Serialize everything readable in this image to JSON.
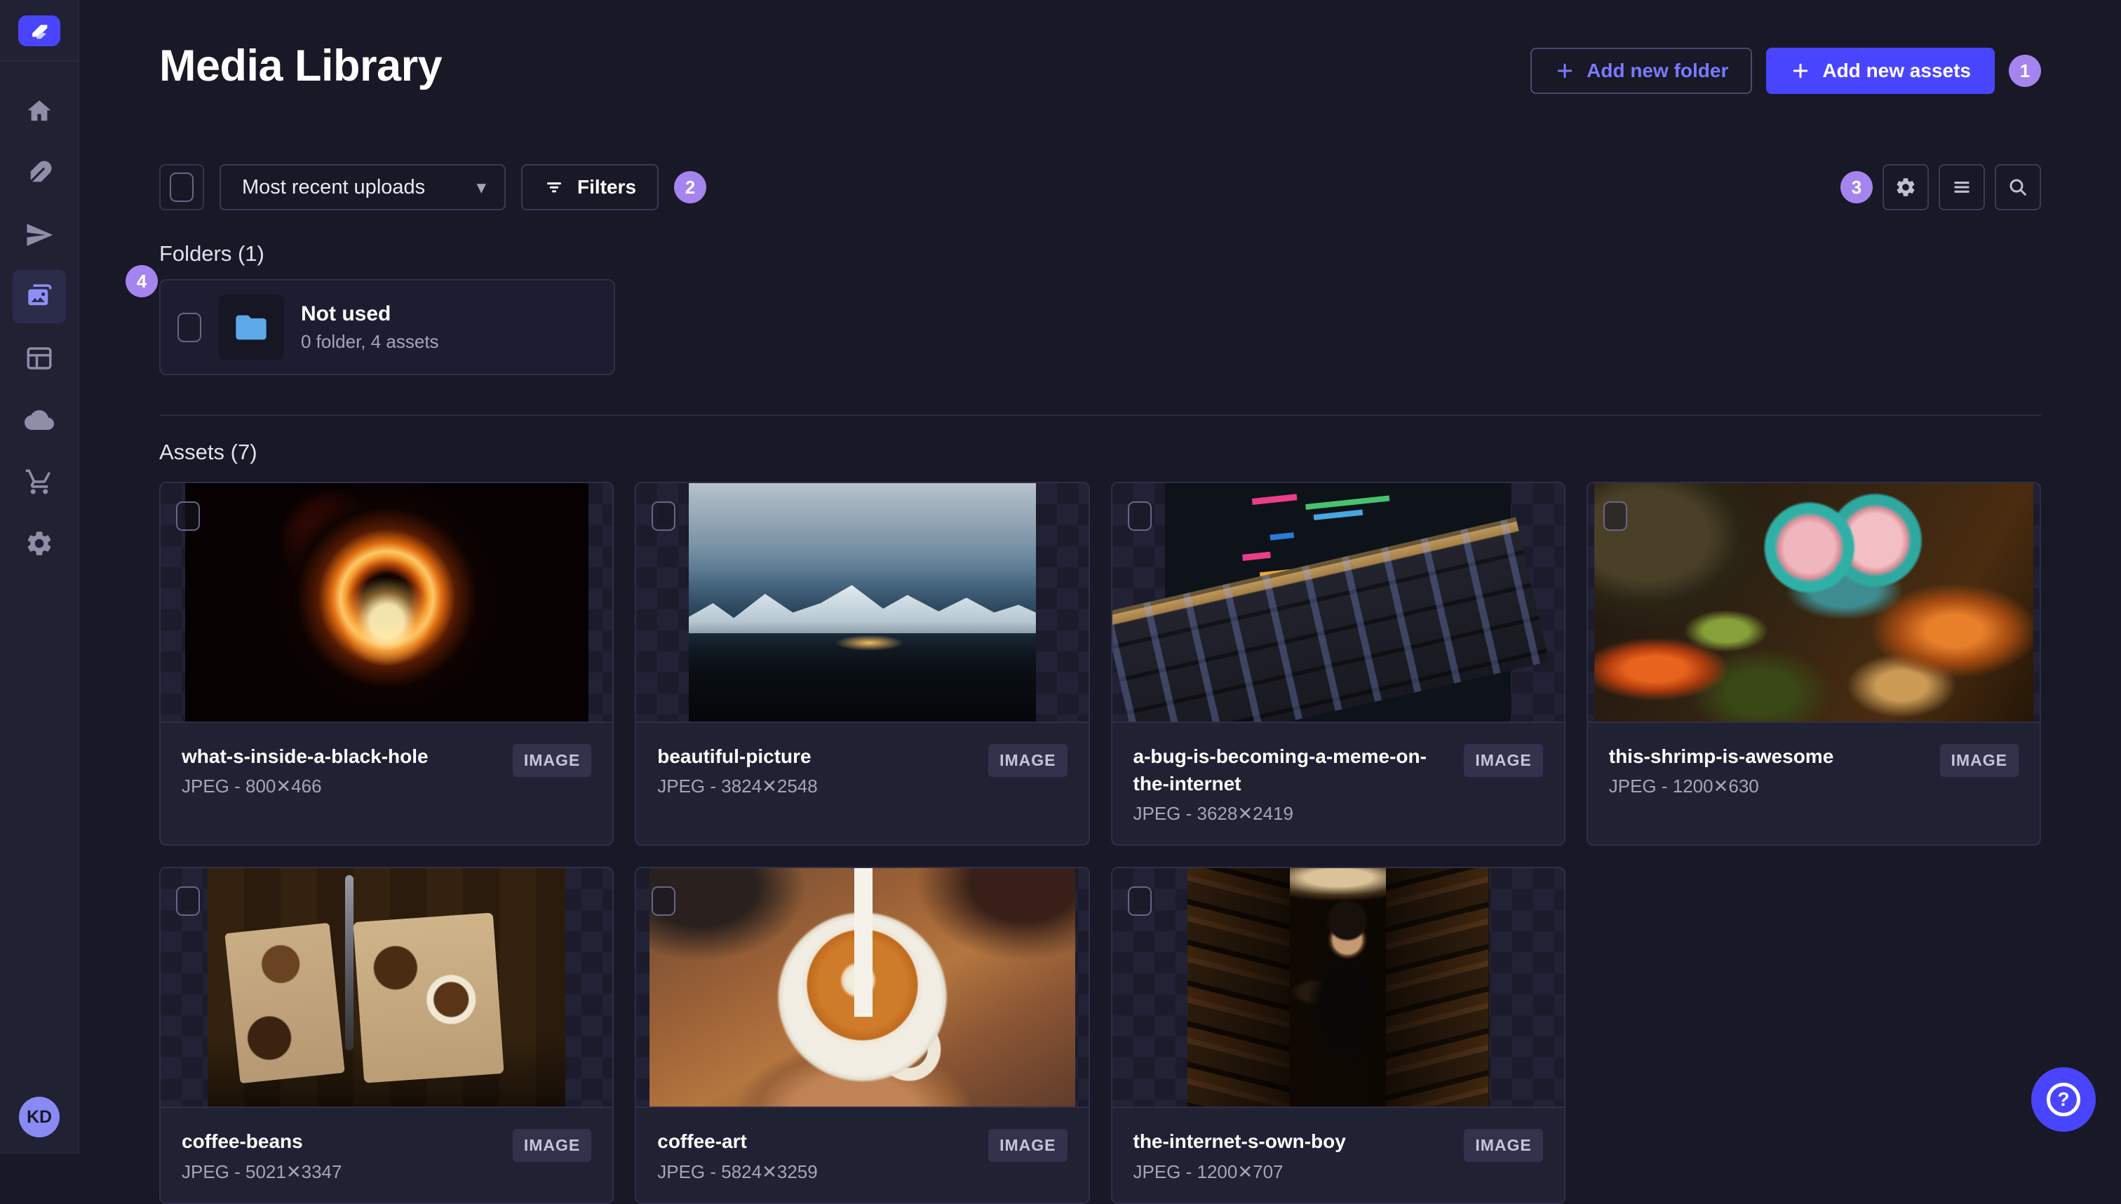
{
  "app": {
    "colors": {
      "background": "#181826",
      "surface": "#212134",
      "border": "#32324d",
      "primary": "#4945ff",
      "primary_text": "#7b79ff",
      "tour_badge": "#a584ef",
      "muted_text": "#a5a5ba",
      "folder_icon_blue": "#5ca8e8",
      "avatar_bg": "#8a8af5"
    }
  },
  "sidebar": {
    "logo_icon": "strapi-logo-icon",
    "items": [
      {
        "icon": "home-icon",
        "active": false
      },
      {
        "icon": "feather-icon",
        "active": false
      },
      {
        "icon": "paper-plane-icon",
        "active": false
      },
      {
        "icon": "media-library-icon",
        "active": true
      },
      {
        "icon": "layout-icon",
        "active": false
      },
      {
        "icon": "cloud-icon",
        "active": false
      },
      {
        "icon": "cart-icon",
        "active": false
      },
      {
        "icon": "gear-icon",
        "active": false
      }
    ],
    "user_initials": "KD"
  },
  "header": {
    "title": "Media Library",
    "add_folder_label": "Add new folder",
    "add_assets_label": "Add new assets"
  },
  "toolbar": {
    "sort_value": "Most recent uploads",
    "filters_label": "Filters"
  },
  "tour_badges": {
    "add_assets": "1",
    "filters": "2",
    "view_settings": "3",
    "folders": "4"
  },
  "folders": {
    "heading": "Folders (1)",
    "items": [
      {
        "name": "Not used",
        "meta": "0 folder, 4 assets",
        "checked": false
      }
    ]
  },
  "assets": {
    "heading": "Assets (7)",
    "type_badge": "IMAGE",
    "items": [
      {
        "name": "what-s-inside-a-black-hole",
        "meta": "JPEG - 800✕466"
      },
      {
        "name": "beautiful-picture",
        "meta": "JPEG - 3824✕2548"
      },
      {
        "name": "a-bug-is-becoming-a-meme-on-the-internet",
        "meta": "JPEG - 3628✕2419"
      },
      {
        "name": "this-shrimp-is-awesome",
        "meta": "JPEG - 1200✕630"
      },
      {
        "name": "coffee-beans",
        "meta": "JPEG - 5021✕3347"
      },
      {
        "name": "coffee-art",
        "meta": "JPEG - 5824✕3259"
      },
      {
        "name": "the-internet-s-own-boy",
        "meta": "JPEG - 1200✕707"
      }
    ]
  },
  "icons": {
    "dropdown_caret": "▾",
    "help": "?"
  }
}
